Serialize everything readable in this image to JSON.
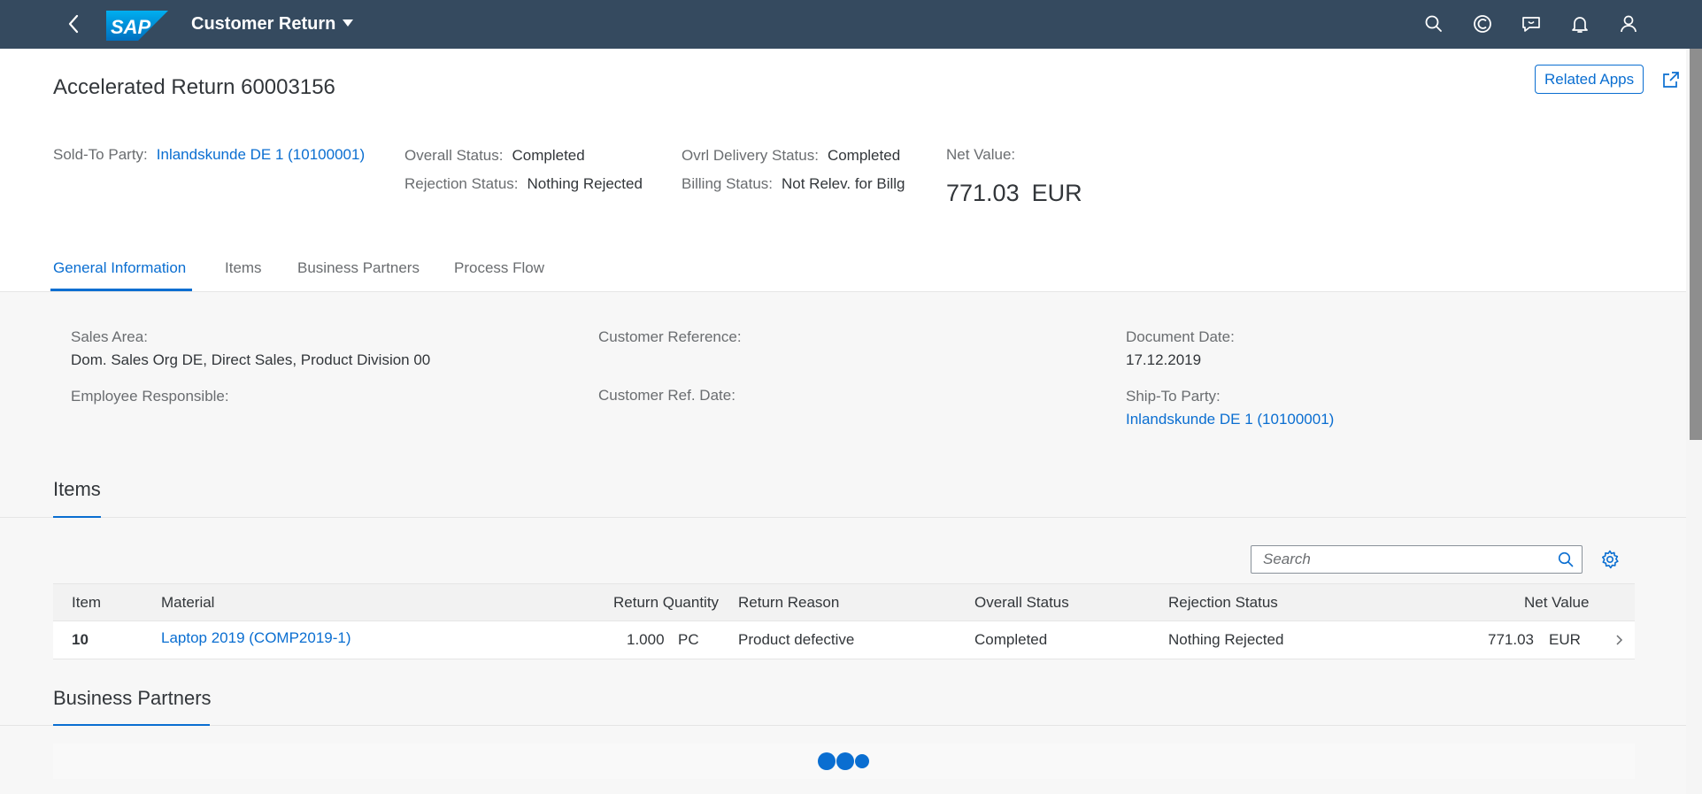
{
  "shell": {
    "app_title": "Customer Return",
    "logo_text": "SAP"
  },
  "header": {
    "title": "Accelerated Return 60003156",
    "related_apps": "Related Apps",
    "sold_to_label": "Sold-To Party:",
    "sold_to_value": "Inlandskunde DE 1 (10100001)",
    "overall_status_label": "Overall Status:",
    "overall_status_value": "Completed",
    "rejection_status_label": "Rejection Status:",
    "rejection_status_value": "Nothing Rejected",
    "delivery_status_label": "Ovrl Delivery Status:",
    "delivery_status_value": "Completed",
    "billing_status_label": "Billing Status:",
    "billing_status_value": "Not Relev. for Billg",
    "net_value_label": "Net Value:",
    "net_value_amount": "771.03",
    "net_value_currency": "EUR"
  },
  "tabs": [
    "General Information",
    "Items",
    "Business Partners",
    "Process Flow"
  ],
  "general_info": {
    "sales_area_label": "Sales Area:",
    "sales_area_value": "Dom. Sales Org DE, Direct Sales, Product Division 00",
    "employee_label": "Employee Responsible:",
    "customer_ref_label": "Customer Reference:",
    "customer_ref_date_label": "Customer Ref. Date:",
    "document_date_label": "Document Date:",
    "document_date_value": "17.12.2019",
    "ship_to_label": "Ship-To Party:",
    "ship_to_value": "Inlandskunde DE 1 (10100001)"
  },
  "items_section": {
    "title": "Items",
    "search_placeholder": "Search",
    "columns": [
      "Item",
      "Material",
      "Return Quantity",
      "Return Reason",
      "Overall Status",
      "Rejection Status",
      "Net Value"
    ],
    "rows": [
      {
        "item": "10",
        "material": "Laptop 2019 (COMP2019-1)",
        "quantity": "1.000",
        "unit": "PC",
        "reason": "Product defective",
        "overall_status": "Completed",
        "rejection_status": "Nothing Rejected",
        "net_value": "771.03",
        "currency": "EUR"
      }
    ]
  },
  "business_partners_section": {
    "title": "Business Partners"
  },
  "icons": {
    "back": "back-icon",
    "search": "search-icon",
    "copilot": "copilot-icon",
    "feedback": "feedback-icon",
    "notifications": "bell-icon",
    "user": "user-icon",
    "share": "share-icon",
    "settings": "gear-icon",
    "row_nav": "chevron-right-icon"
  },
  "colors": {
    "shell_bg": "#354a5f",
    "accent": "#0a6ed1",
    "page_bg": "#f7f7f7"
  }
}
